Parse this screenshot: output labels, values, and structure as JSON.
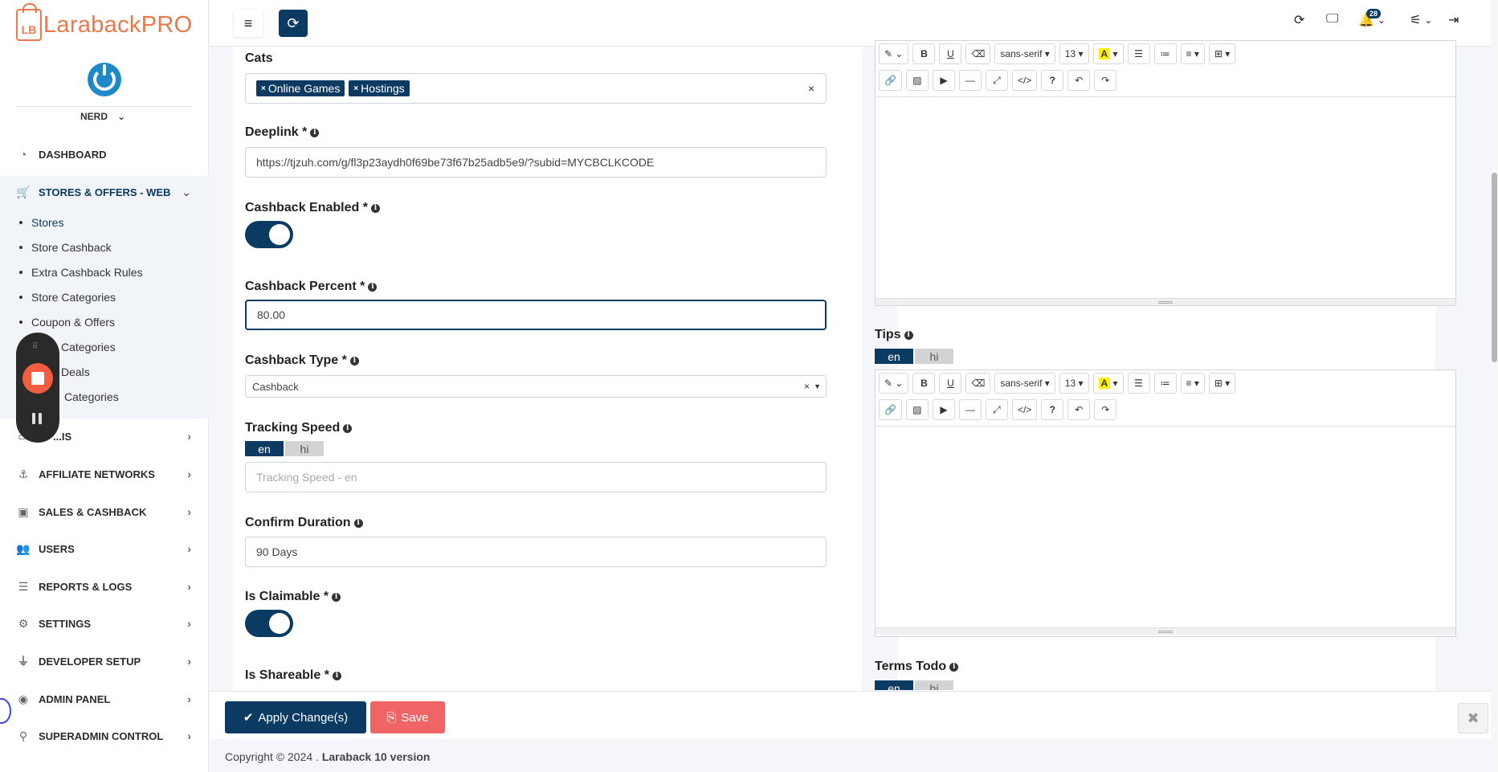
{
  "brand": {
    "logo_mark": "LB",
    "name": "LarabackPRO"
  },
  "user": {
    "name": "NERD"
  },
  "sidebar": {
    "items": [
      {
        "label": "DASHBOARD",
        "icon": "gauge-icon"
      },
      {
        "label": "STORES & OFFERS - WEB",
        "icon": "cart-icon"
      },
      {
        "label": "...IS",
        "icon": "card-icon"
      },
      {
        "label": "AFFILIATE NETWORKS",
        "icon": "anchor-icon"
      },
      {
        "label": "SALES & CASHBACK",
        "icon": "money-icon"
      },
      {
        "label": "USERS",
        "icon": "users-icon"
      },
      {
        "label": "REPORTS & LOGS",
        "icon": "list-icon"
      },
      {
        "label": "SETTINGS",
        "icon": "gears-icon"
      },
      {
        "label": "DEVELOPER SETUP",
        "icon": "plug-icon"
      },
      {
        "label": "ADMIN PANEL",
        "icon": "shield-icon"
      },
      {
        "label": "SUPERADMIN CONTROL",
        "icon": "sitemap-icon"
      }
    ],
    "subitems": [
      "Stores",
      "Store Cashback",
      "Extra Cashback Rules",
      "Store Categories",
      "Coupon & Offers",
      "Categories",
      "Deals",
      "Categories"
    ]
  },
  "topbar": {
    "notifications_count": "28"
  },
  "form": {
    "cats": {
      "label": "Cats",
      "tags": [
        "Online Games",
        "Hostings"
      ],
      "clear": "×"
    },
    "deeplink": {
      "label": "Deeplink *",
      "value": "https://tjzuh.com/g/fl3p23aydh0f69be73f67b25adb5e9/?subid=MYCBCLKCODE"
    },
    "cashback_enabled": {
      "label": "Cashback Enabled *"
    },
    "cashback_percent": {
      "label": "Cashback Percent *",
      "value": "80.00"
    },
    "cashback_type": {
      "label": "Cashback Type *",
      "value": "Cashback",
      "clear": "×"
    },
    "tracking_speed": {
      "label": "Tracking Speed",
      "placeholder": "Tracking Speed - en"
    },
    "confirm_duration": {
      "label": "Confirm Duration",
      "value": "90 Days"
    },
    "is_claimable": {
      "label": "Is Claimable *"
    },
    "is_shareable": {
      "label": "Is Shareable *"
    },
    "tips": {
      "label": "Tips"
    },
    "terms_todo": {
      "label": "Terms Todo"
    }
  },
  "lang_tabs": [
    "en",
    "hi"
  ],
  "editor": {
    "font": "sans-serif",
    "size": "13",
    "color_btn": "A",
    "help_btn": "?",
    "underline": "U",
    "bold": "B"
  },
  "footer": {
    "apply_label": "Apply Change(s)",
    "save_label": "Save",
    "close_label": "✖"
  },
  "copyright": {
    "prefix": "Copyright © 2024 .",
    "suffix": "Laraback 10 version"
  }
}
